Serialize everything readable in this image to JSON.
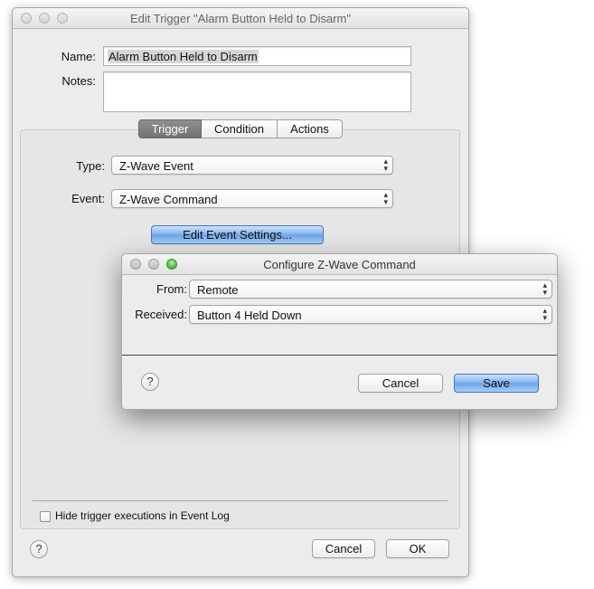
{
  "main_window": {
    "title": "Edit Trigger \"Alarm Button Held to Disarm\"",
    "name_label": "Name:",
    "name_value": "Alarm Button Held to Disarm",
    "notes_label": "Notes:",
    "notes_value": "",
    "tabs": [
      {
        "label": "Trigger",
        "active": true
      },
      {
        "label": "Condition",
        "active": false
      },
      {
        "label": "Actions",
        "active": false
      }
    ],
    "type_label": "Type:",
    "type_value": "Z-Wave Event",
    "event_label": "Event:",
    "event_value": "Z-Wave Command",
    "edit_settings_label": "Edit Event Settings...",
    "hide_checkbox_label": "Hide trigger executions in Event Log",
    "hide_checkbox_checked": false,
    "help_label": "?",
    "cancel_label": "Cancel",
    "ok_label": "OK"
  },
  "dialog": {
    "title": "Configure Z-Wave Command",
    "from_label": "From:",
    "from_value": "Remote",
    "received_label": "Received:",
    "received_value": "Button 4 Held Down",
    "help_label": "?",
    "cancel_label": "Cancel",
    "save_label": "Save"
  },
  "icons": {
    "popup_arrows": "up-down-chevron-icon",
    "help": "question-mark-icon"
  },
  "colors": {
    "accent_button": "#7fb0ee",
    "active_tab": "#7d7d7d",
    "window_bg": "#ececec"
  }
}
